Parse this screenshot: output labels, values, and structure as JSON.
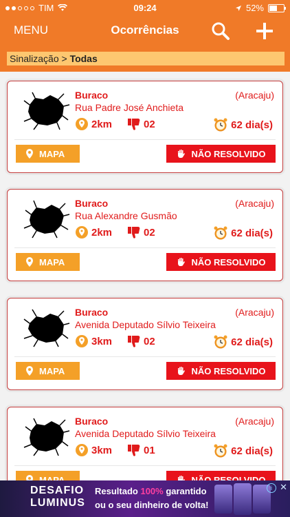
{
  "status": {
    "carrier": "TIM",
    "time": "09:24",
    "battery": "52%"
  },
  "nav": {
    "menu_label": "MENU",
    "title": "Ocorrências"
  },
  "breadcrumb": {
    "parent": "Sinalização >",
    "current": "Todas"
  },
  "cards": [
    {
      "type": "Buraco",
      "city": "(Aracaju)",
      "street": "Rua Padre José Anchieta",
      "distance": "2km",
      "votes": "02",
      "days": "62 dia(s)",
      "map_label": "MAPA",
      "status_label": "NÃO RESOLVIDO"
    },
    {
      "type": "Buraco",
      "city": "(Aracaju)",
      "street": "Rua Alexandre Gusmão",
      "distance": "2km",
      "votes": "02",
      "days": "62 dia(s)",
      "map_label": "MAPA",
      "status_label": "NÃO RESOLVIDO"
    },
    {
      "type": "Buraco",
      "city": "(Aracaju)",
      "street": "Avenida Deputado Sílvio Teixeira",
      "distance": "3km",
      "votes": "02",
      "days": "62 dia(s)",
      "map_label": "MAPA",
      "status_label": "NÃO RESOLVIDO"
    },
    {
      "type": "Buraco",
      "city": "(Aracaju)",
      "street": "Avenida Deputado Sílvio Teixeira",
      "distance": "3km",
      "votes": "01",
      "days": "62 dia(s)",
      "map_label": "MAPA",
      "status_label": "NÃO RESOLVIDO"
    }
  ],
  "ad": {
    "brand_line1": "DESAFIO",
    "brand_line2": "LUMINUS",
    "line1_prefix": "Resultado ",
    "line1_pct": "100%",
    "line1_suffix": " garantido",
    "line2": "ou o seu dinheiro de volta!"
  },
  "colors": {
    "primary": "#f07a28",
    "accent_red": "#e8131b",
    "map_button": "#f4a028",
    "breadcrumb_bg": "#fdc770"
  },
  "icons": [
    "search-icon",
    "plus-icon",
    "location-pin-icon",
    "thumbs-down-icon",
    "alarm-clock-icon",
    "hand-stop-icon",
    "pothole-icon"
  ]
}
